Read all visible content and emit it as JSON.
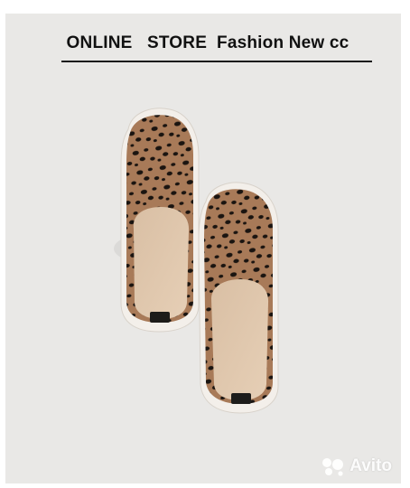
{
  "header": {
    "title": "ONLINE   STORE  Fashion New cc"
  },
  "product_image": {
    "icon": "leopard-slip-on-shoes-image",
    "pattern_color": "#a87a58",
    "spot_color": "#1a1410",
    "sole_color": "#f3efea"
  },
  "watermark": {
    "text": "Avito",
    "icon": "avito-logo-icon"
  }
}
